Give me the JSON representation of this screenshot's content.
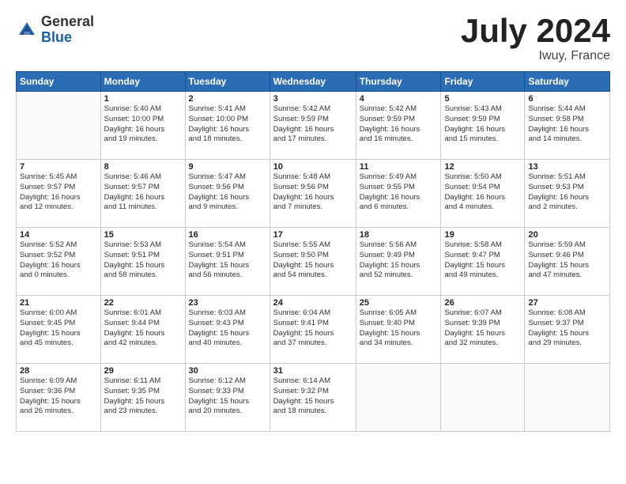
{
  "header": {
    "logo_general": "General",
    "logo_blue": "Blue",
    "month_title": "July 2024",
    "location": "Iwuy, France"
  },
  "weekdays": [
    "Sunday",
    "Monday",
    "Tuesday",
    "Wednesday",
    "Thursday",
    "Friday",
    "Saturday"
  ],
  "weeks": [
    [
      {
        "day": "",
        "info": ""
      },
      {
        "day": "1",
        "info": "Sunrise: 5:40 AM\nSunset: 10:00 PM\nDaylight: 16 hours\nand 19 minutes."
      },
      {
        "day": "2",
        "info": "Sunrise: 5:41 AM\nSunset: 10:00 PM\nDaylight: 16 hours\nand 18 minutes."
      },
      {
        "day": "3",
        "info": "Sunrise: 5:42 AM\nSunset: 9:59 PM\nDaylight: 16 hours\nand 17 minutes."
      },
      {
        "day": "4",
        "info": "Sunrise: 5:42 AM\nSunset: 9:59 PM\nDaylight: 16 hours\nand 16 minutes."
      },
      {
        "day": "5",
        "info": "Sunrise: 5:43 AM\nSunset: 9:59 PM\nDaylight: 16 hours\nand 15 minutes."
      },
      {
        "day": "6",
        "info": "Sunrise: 5:44 AM\nSunset: 9:58 PM\nDaylight: 16 hours\nand 14 minutes."
      }
    ],
    [
      {
        "day": "7",
        "info": "Sunrise: 5:45 AM\nSunset: 9:57 PM\nDaylight: 16 hours\nand 12 minutes."
      },
      {
        "day": "8",
        "info": "Sunrise: 5:46 AM\nSunset: 9:57 PM\nDaylight: 16 hours\nand 11 minutes."
      },
      {
        "day": "9",
        "info": "Sunrise: 5:47 AM\nSunset: 9:56 PM\nDaylight: 16 hours\nand 9 minutes."
      },
      {
        "day": "10",
        "info": "Sunrise: 5:48 AM\nSunset: 9:56 PM\nDaylight: 16 hours\nand 7 minutes."
      },
      {
        "day": "11",
        "info": "Sunrise: 5:49 AM\nSunset: 9:55 PM\nDaylight: 16 hours\nand 6 minutes."
      },
      {
        "day": "12",
        "info": "Sunrise: 5:50 AM\nSunset: 9:54 PM\nDaylight: 16 hours\nand 4 minutes."
      },
      {
        "day": "13",
        "info": "Sunrise: 5:51 AM\nSunset: 9:53 PM\nDaylight: 16 hours\nand 2 minutes."
      }
    ],
    [
      {
        "day": "14",
        "info": "Sunrise: 5:52 AM\nSunset: 9:52 PM\nDaylight: 16 hours\nand 0 minutes."
      },
      {
        "day": "15",
        "info": "Sunrise: 5:53 AM\nSunset: 9:51 PM\nDaylight: 15 hours\nand 58 minutes."
      },
      {
        "day": "16",
        "info": "Sunrise: 5:54 AM\nSunset: 9:51 PM\nDaylight: 15 hours\nand 56 minutes."
      },
      {
        "day": "17",
        "info": "Sunrise: 5:55 AM\nSunset: 9:50 PM\nDaylight: 15 hours\nand 54 minutes."
      },
      {
        "day": "18",
        "info": "Sunrise: 5:56 AM\nSunset: 9:49 PM\nDaylight: 15 hours\nand 52 minutes."
      },
      {
        "day": "19",
        "info": "Sunrise: 5:58 AM\nSunset: 9:47 PM\nDaylight: 15 hours\nand 49 minutes."
      },
      {
        "day": "20",
        "info": "Sunrise: 5:59 AM\nSunset: 9:46 PM\nDaylight: 15 hours\nand 47 minutes."
      }
    ],
    [
      {
        "day": "21",
        "info": "Sunrise: 6:00 AM\nSunset: 9:45 PM\nDaylight: 15 hours\nand 45 minutes."
      },
      {
        "day": "22",
        "info": "Sunrise: 6:01 AM\nSunset: 9:44 PM\nDaylight: 15 hours\nand 42 minutes."
      },
      {
        "day": "23",
        "info": "Sunrise: 6:03 AM\nSunset: 9:43 PM\nDaylight: 15 hours\nand 40 minutes."
      },
      {
        "day": "24",
        "info": "Sunrise: 6:04 AM\nSunset: 9:41 PM\nDaylight: 15 hours\nand 37 minutes."
      },
      {
        "day": "25",
        "info": "Sunrise: 6:05 AM\nSunset: 9:40 PM\nDaylight: 15 hours\nand 34 minutes."
      },
      {
        "day": "26",
        "info": "Sunrise: 6:07 AM\nSunset: 9:39 PM\nDaylight: 15 hours\nand 32 minutes."
      },
      {
        "day": "27",
        "info": "Sunrise: 6:08 AM\nSunset: 9:37 PM\nDaylight: 15 hours\nand 29 minutes."
      }
    ],
    [
      {
        "day": "28",
        "info": "Sunrise: 6:09 AM\nSunset: 9:36 PM\nDaylight: 15 hours\nand 26 minutes."
      },
      {
        "day": "29",
        "info": "Sunrise: 6:11 AM\nSunset: 9:35 PM\nDaylight: 15 hours\nand 23 minutes."
      },
      {
        "day": "30",
        "info": "Sunrise: 6:12 AM\nSunset: 9:33 PM\nDaylight: 15 hours\nand 20 minutes."
      },
      {
        "day": "31",
        "info": "Sunrise: 6:14 AM\nSunset: 9:32 PM\nDaylight: 15 hours\nand 18 minutes."
      },
      {
        "day": "",
        "info": ""
      },
      {
        "day": "",
        "info": ""
      },
      {
        "day": "",
        "info": ""
      }
    ]
  ]
}
